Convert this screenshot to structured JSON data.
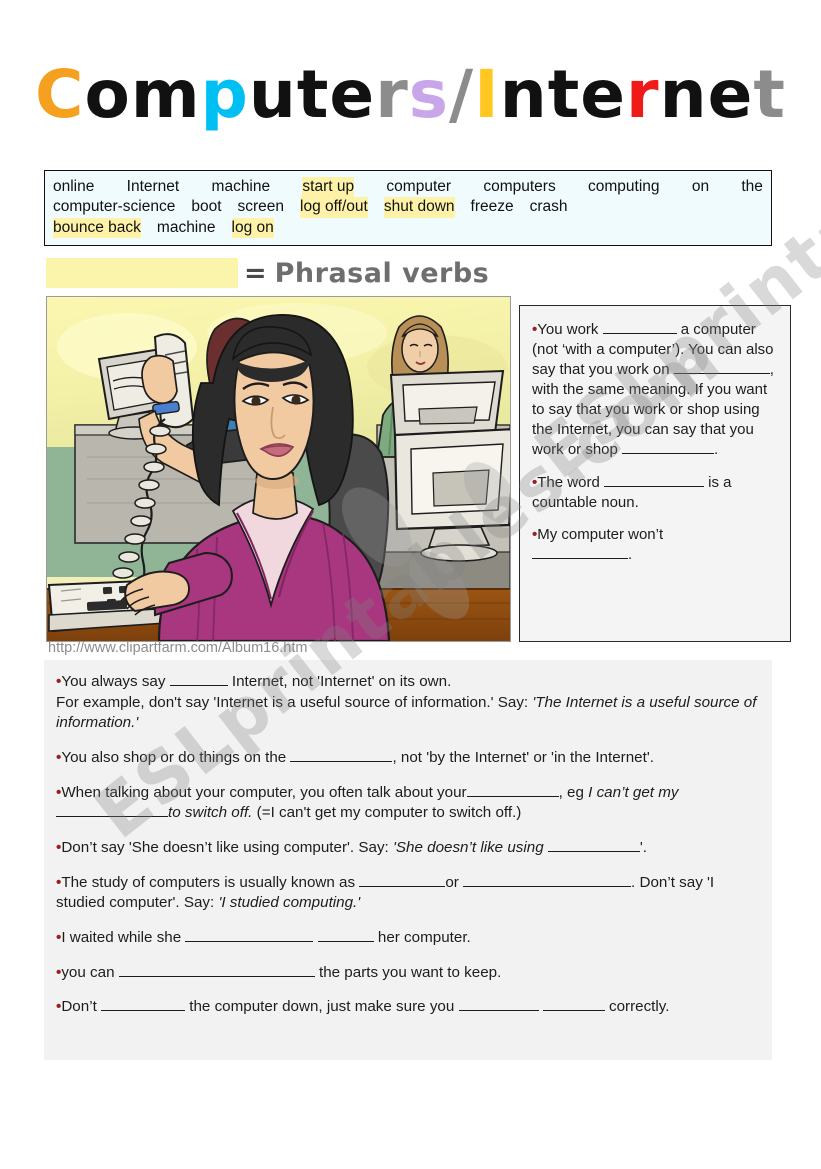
{
  "page": {
    "title_parts": [
      {
        "t": "C",
        "c": "#f5a01e"
      },
      {
        "t": "o",
        "c": "#111111"
      },
      {
        "t": "m",
        "c": "#111111"
      },
      {
        "t": "p",
        "c": "#00bff3"
      },
      {
        "t": "u",
        "c": "#111111"
      },
      {
        "t": "t",
        "c": "#111111"
      },
      {
        "t": "e",
        "c": "#111111"
      },
      {
        "t": "r",
        "c": "#8c8c8c"
      },
      {
        "t": "s",
        "c": "#c9a6ea"
      },
      {
        "t": "/",
        "c": "#8c8c8c"
      },
      {
        "t": "I",
        "c": "#ffc71f"
      },
      {
        "t": "n",
        "c": "#111111"
      },
      {
        "t": "t",
        "c": "#111111"
      },
      {
        "t": "e",
        "c": "#111111"
      },
      {
        "t": "r",
        "c": "#ee1b18"
      },
      {
        "t": "n",
        "c": "#111111"
      },
      {
        "t": "e",
        "c": "#111111"
      },
      {
        "t": "t",
        "c": "#8c8c8c"
      }
    ],
    "title_plain": "Computers/Internet",
    "watermark": "ESLprintables.com",
    "colors": {
      "orange": "#f5a01e",
      "cyan": "#00bff3",
      "gray": "#8c8c8c",
      "lavender": "#c9a6ea",
      "gold": "#ffc71f",
      "red": "#ee1b18",
      "highlight_yellow": "#fdf2a8",
      "wordbank_bg": "#effbfd",
      "notes_bg": "#f2f2f2",
      "bullet_red": "#9c1f1f"
    }
  },
  "wordbank": {
    "line1": [
      {
        "text": "online",
        "highlight": false
      },
      {
        "text": "Internet",
        "highlight": false
      },
      {
        "text": "machine",
        "highlight": false
      },
      {
        "text": "start up",
        "highlight": true
      },
      {
        "text": "computer",
        "highlight": false
      },
      {
        "text": "computers",
        "highlight": false
      },
      {
        "text": "computing",
        "highlight": false
      },
      {
        "text": "on",
        "highlight": false
      },
      {
        "text": "the",
        "highlight": false
      }
    ],
    "line2": [
      {
        "text": "computer-science",
        "highlight": false
      },
      {
        "text": "boot",
        "highlight": false
      },
      {
        "text": "screen",
        "highlight": false
      },
      {
        "text": "log off/out",
        "highlight": true
      },
      {
        "text": "shut down",
        "highlight": true
      },
      {
        "text": "freeze",
        "highlight": false
      },
      {
        "text": "crash",
        "highlight": false
      }
    ],
    "line3": [
      {
        "text": "bounce back",
        "highlight": true
      },
      {
        "text": "machine",
        "highlight": false
      },
      {
        "text": "log on",
        "highlight": true
      }
    ]
  },
  "legend": {
    "equals": "=",
    "label": "Phrasal verbs"
  },
  "illustration": {
    "alt": "Clipart of an office: woman in magenta blazer typing at a keyboard and holding a telephone handset, with two colleagues at computer monitors behind her",
    "credit": "http://www.clipartfarm.com/Album16.htm"
  },
  "sidebox": {
    "items": [
      "You work __________ a computer (not ‘with a computer’). You can also say that you work on ____________, with the same meaning. If you want to say that you work or shop using the Internet, you can say that you work or shop ____________.",
      "The word ____________ is a countable noun.",
      "My computer won’t ____________."
    ]
  },
  "notes": {
    "items": [
      {
        "plain": "You always say _______ Internet, not 'Internet' on its own.",
        "html": "You always say <span class=\"blank\" style=\"width:58px\"></span> Internet, not 'Internet' on its own.<br>For example, don't say 'Internet is a useful source of information.' Say: <i>'The Internet is a useful source of information.'</i>"
      },
      {
        "plain": "You also shop or do things on the ____________, not 'by the Internet' or 'in the Internet'.",
        "html": "You also shop or do things on the <span class=\"blank\" style=\"width:102px\"></span>, not 'by the Internet' or 'in the Internet'."
      },
      {
        "plain": "When talking about your computer, you often talk about your___________, eg I can’t get my ________ to switch off. (=I can't get my computer to switch off.)",
        "html": "When talking about your computer, you often talk about your<span class=\"blank\" style=\"width:92px\"></span>, eg <i>I can’t get my</i><br><span class=\"blank\" style=\"width:112px\"></span><i>to switch off.</i>  (=I can't get my computer to switch off.)"
      },
      {
        "plain": "Don’t say 'She doesn’t like using computer'. Say: 'She doesn’t like using ___________'.",
        "html": "Don’t say 'She doesn’t like using computer'. Say: <i>'She doesn’t like using</i> <span class=\"blank\" style=\"width:92px\"></span>'."
      },
      {
        "plain": "The study of computers is usually known as __________or ______________________. Don’t say 'I studied computer'. Say: 'I studied computing.'",
        "html": "The study of computers is usually known as <span class=\"blank\" style=\"width:86px\"></span>or <span class=\"blank\" style=\"width:168px\"></span>. Don’t say 'I studied computer'. Say: <i>'I studied computing.'</i>"
      },
      {
        "plain": "I waited while she _______________ ______ her computer.",
        "html": "I waited while she <span class=\"blank\" style=\"width:128px\"></span> <span class=\"blank\" style=\"width:56px\"></span> her computer."
      },
      {
        "plain": "you can ________________________ the parts you want to keep.",
        "html": "you can <span class=\"blank\" style=\"width:196px\"></span> the parts you want to keep."
      },
      {
        "plain": "Don’t __________ the computer down, just make sure you _________ _______ correctly.",
        "html": "Don’t <span class=\"blank\" style=\"width:84px\"></span> the computer down, just make sure you <span class=\"blank\" style=\"width:80px\"></span> <span class=\"blank\" style=\"width:62px\"></span> correctly."
      }
    ]
  }
}
